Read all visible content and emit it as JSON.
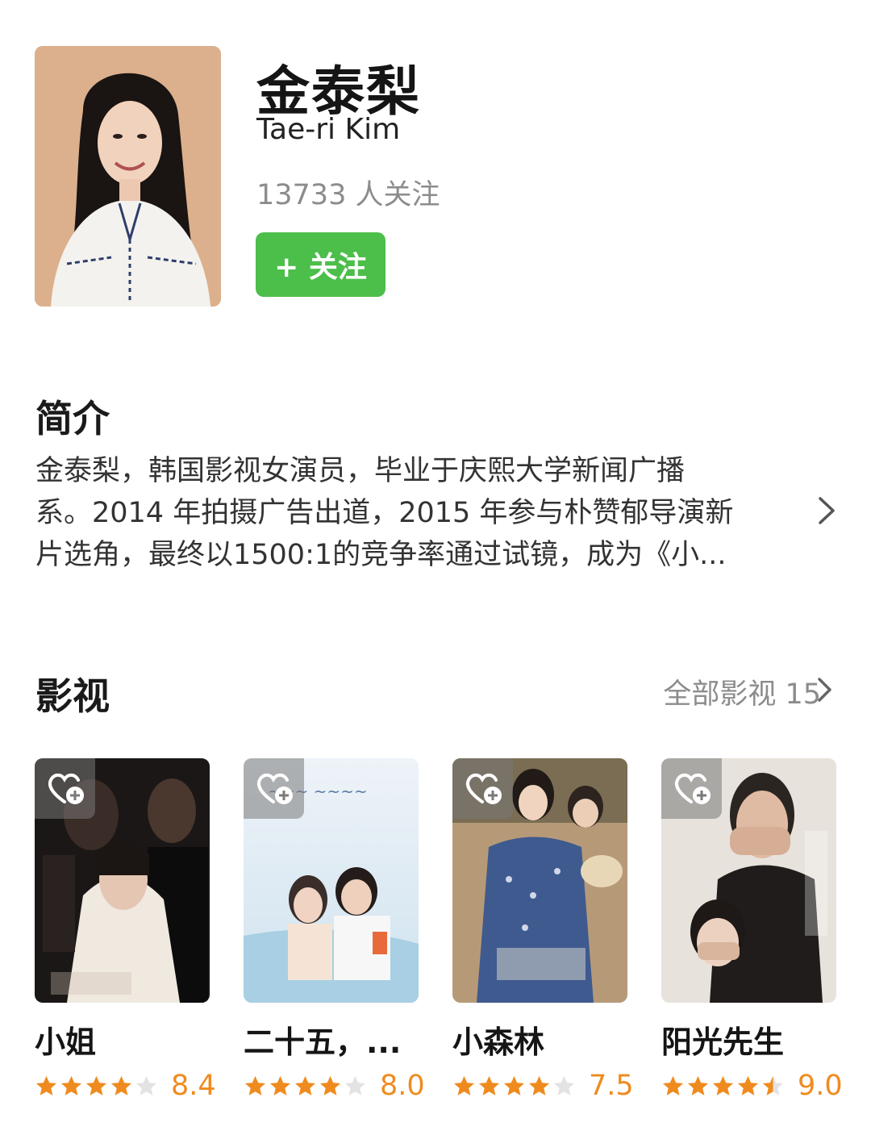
{
  "person": {
    "name_cn": "金泰梨",
    "name_en": "Tae-ri Kim",
    "followers": "13733 人关注",
    "follow_label": "+ 关注"
  },
  "intro": {
    "title": "简介",
    "lines": [
      "金泰梨，韩国影视女演员，毕业于庆熙大学新闻广播",
      "系。2014 年拍摄广告出道，2015 年参与朴赞郁导演新",
      "片选角，最终以1500:1的竞争率通过试镜，成为《小..."
    ]
  },
  "films": {
    "title": "影视",
    "all_label": "全部影视 15",
    "items": [
      {
        "title": "小姐",
        "rating": 4,
        "score": "8.4"
      },
      {
        "title": "二十五，...",
        "rating": 4,
        "score": "8.0"
      },
      {
        "title": "小森林",
        "rating": 4,
        "score": "7.5"
      },
      {
        "title": "阳光先生",
        "rating": 4.5,
        "score": "9.0"
      }
    ]
  },
  "colors": {
    "accent_green": "#4cbe4a",
    "star_orange": "#ef8b1e",
    "secondary_text": "#8c8c8c"
  },
  "icons": [
    "chevron-right-icon",
    "heart-plus-icon",
    "star-icon"
  ]
}
